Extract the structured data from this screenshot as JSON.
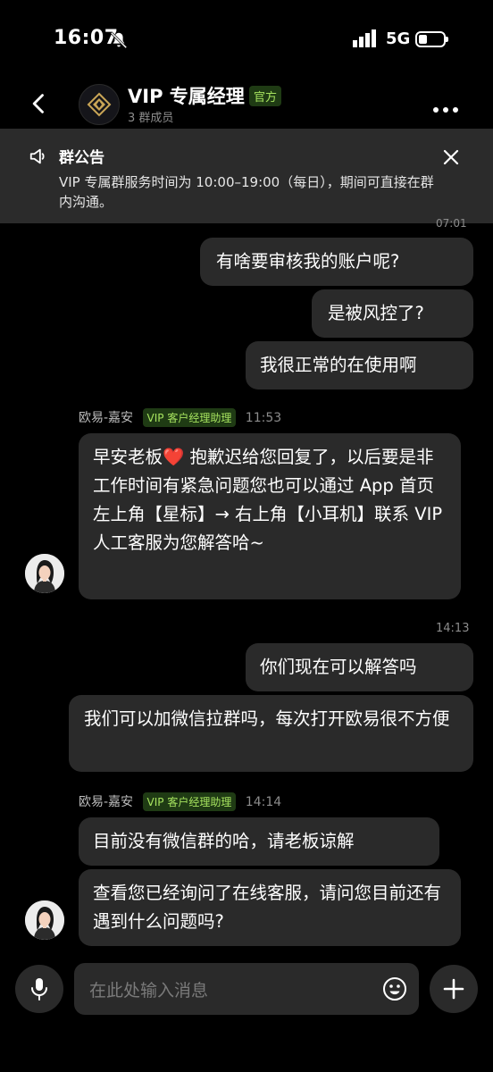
{
  "status_bar": {
    "time": "16:07",
    "network": "5G"
  },
  "header": {
    "title": "VIP 专属经理",
    "official_badge": "官方",
    "members": "3 群成员"
  },
  "notice": {
    "title": "群公告",
    "body": "VIP 专属群服务时间为 10:00–19:00（每日），期间可直接在群内沟通。"
  },
  "cut_timestamp": "07:01",
  "messages": {
    "m1": "有啥要审核我的账户呢?",
    "m2": "是被风控了?",
    "m3": "我很正常的在使用啊",
    "g1_name": "欧易-嘉安",
    "g1_badge": "VIP 客户经理助理",
    "g1_time": "11:53",
    "m4_a": "早安老板",
    "m4_heart": "❤️",
    "m4_b": " 抱歉迟给您回复了，以后要是非工作时间有紧急问题您也可以通过 App 首页左上角【星标】→ 右上角【小耳机】联系 VIP 人工客服为您解答哈~",
    "ts_1413": "14:13",
    "m5": "你们现在可以解答吗",
    "m6": "我们可以加微信拉群吗，每次打开欧易很不方便",
    "g2_name": "欧易-嘉安",
    "g2_badge": "VIP 客户经理助理",
    "g2_time": "14:14",
    "m7": "目前没有微信群的哈，请老板谅解",
    "m8": "查看您已经询问了在线客服，请问您目前还有遇到什么问题吗?"
  },
  "input": {
    "placeholder": "在此处输入消息"
  },
  "icons": {
    "back": "chevron-left-icon",
    "more": "more-dots-icon",
    "speaker": "megaphone-icon",
    "close": "close-icon",
    "mic": "microphone-icon",
    "emoji": "emoji-icon",
    "plus": "plus-icon"
  },
  "colors": {
    "accent_green": "#a6e35f",
    "bubble": "#2a2a2a",
    "background": "#000000"
  }
}
